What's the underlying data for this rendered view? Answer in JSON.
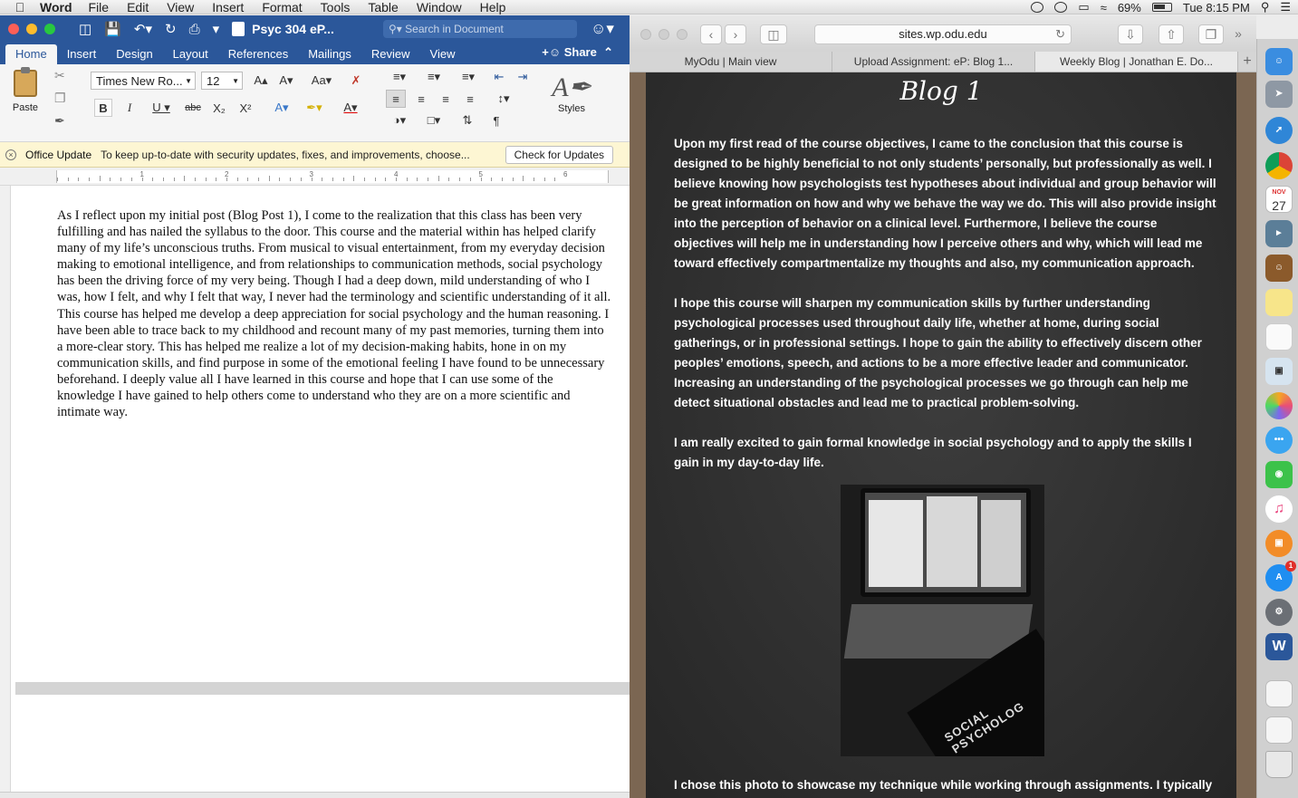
{
  "menubar": {
    "app": "Word",
    "items": [
      "File",
      "Edit",
      "View",
      "Insert",
      "Format",
      "Tools",
      "Table",
      "Window",
      "Help"
    ],
    "battery": "69%",
    "clock": "Tue 8:15 PM"
  },
  "word": {
    "doc_title": "Psyc 304 eP...",
    "search_placeholder": "Search in Document",
    "tabs": [
      "Home",
      "Insert",
      "Design",
      "Layout",
      "References",
      "Mailings",
      "Review",
      "View"
    ],
    "share_label": "Share",
    "paste_label": "Paste",
    "font_name": "Times New Ro...",
    "font_size": "12",
    "styles_label": "Styles",
    "update_title": "Office Update",
    "update_message": "To keep up-to-date with security updates, fixes, and improvements, choose...",
    "update_button": "Check for Updates",
    "ruler_numbers": [
      "1",
      "2",
      "3",
      "4",
      "5",
      "6"
    ],
    "body_text": "As I reflect upon my initial post (Blog Post 1), I come to the realization that this class has been very fulfilling and has nailed the syllabus to the door. This course and the material within has helped clarify many of my life’s unconscious truths. From musical to visual entertainment, from my everyday decision making to emotional intelligence, and from relationships to communication methods, social psychology has been the driving force of my very being. Though I had a deep down, mild understanding of who I was, how I felt, and why I felt that way, I never had the terminology and scientific understanding of it all. This course has helped me develop a deep appreciation for social psychology and the human reasoning. I have been able to trace back to my childhood and recount many of my past memories, turning them into a more-clear story. This has helped me realize a lot of my decision-making habits, hone in on my communication skills, and find purpose in some of the emotional feeling I have found to be unnecessary beforehand. I deeply value all I have learned in this course and hope that I can use some of the knowledge I have gained to help others come to understand who they are on a more scientific and intimate way."
  },
  "safari": {
    "url": "sites.wp.odu.edu",
    "tabs": [
      "MyOdu | Main view",
      "Upload Assignment: eP: Blog 1...",
      "Weekly Blog | Jonathan E. Do..."
    ],
    "blog_title": "Blog 1",
    "paragraphs": [
      "Upon my first read of the course objectives, I came to the conclusion that this course is designed to be highly beneficial to not only students’ personally, but professionally as well. I believe knowing how psychologists test hypotheses about individual and group behavior will be great information on how and why we behave the way we do. This will also provide insight into the perception of behavior on a clinical level. Furthermore, I believe the course objectives will help me in understanding how I perceive others and why, which will lead me toward effectively compartmentalize my thoughts and also, my communication approach.",
      "I hope this course will sharpen my communication skills by further understanding psychological processes used throughout daily life, whether at home, during social gatherings, or in professional settings. I hope to gain the ability to effectively discern other peoples’ emotions, speech, and actions to be a more effective leader and communicator. Increasing an understanding of the psychological processes we go through can help me detect situational obstacles and lead me to practical problem-solving.",
      "I am really excited to gain formal knowledge in social psychology and to apply the skills I gain in my day-to-day life.",
      "I chose this photo to showcase my technique while working through assignments. I typically"
    ],
    "photo_book_text": "SOCIAL PSYCHOLOG"
  },
  "dock": {
    "calendar_month": "NOV",
    "calendar_day": "27",
    "appstore_badge": "1",
    "word_letter": "W"
  },
  "colors": {
    "word_blue": "#2b579a",
    "chalkboard": "#2e2e2e",
    "update_bar": "#fdf6d3"
  }
}
